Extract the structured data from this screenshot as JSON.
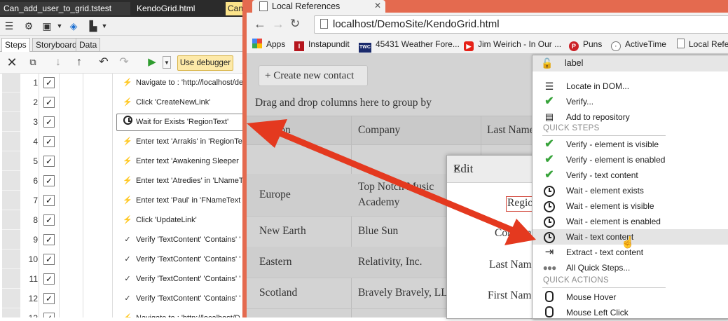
{
  "studio": {
    "doc_tabs": [
      "Can_add_user_to_grid.tstest",
      "KendoGrid.html",
      "Can"
    ],
    "sub_tabs": [
      "Steps",
      "Storyboard",
      "Data"
    ],
    "use_debugger_label": "Use debugger",
    "steps": [
      {
        "num": "1",
        "icon": "bolt",
        "text": "Navigate to : 'http://localhost/de"
      },
      {
        "num": "2",
        "icon": "bolt",
        "text": "Click 'CreateNewLink'"
      },
      {
        "num": "3",
        "icon": "clock",
        "text": "Wait for Exists 'RegionText'",
        "selected": true
      },
      {
        "num": "4",
        "icon": "bolt",
        "text": "Enter text 'Arrakis' in 'RegionTe"
      },
      {
        "num": "5",
        "icon": "bolt",
        "text": "Enter text 'Awakening Sleeper"
      },
      {
        "num": "6",
        "icon": "bolt",
        "text": "Enter text 'Atredies' in 'LNameT"
      },
      {
        "num": "7",
        "icon": "bolt",
        "text": "Enter text 'Paul' in 'FNameText"
      },
      {
        "num": "8",
        "icon": "bolt",
        "text": "Click 'UpdateLink'"
      },
      {
        "num": "9",
        "icon": "check",
        "text": "Verify 'TextContent' 'Contains' '"
      },
      {
        "num": "10",
        "icon": "check",
        "text": "Verify 'TextContent' 'Contains' '"
      },
      {
        "num": "11",
        "icon": "check",
        "text": "Verify 'TextContent' 'Contains' '"
      },
      {
        "num": "12",
        "icon": "check",
        "text": "Verify 'TextContent' 'Contains' '"
      },
      {
        "num": "13",
        "icon": "bolt",
        "text": "Navigate to : 'http://localhost/D"
      }
    ]
  },
  "browser": {
    "tab_title": "Local References",
    "url": "localhost/DemoSite/KendoGrid.html",
    "bookmarks": [
      "Apps",
      "Instapundit",
      "45431 Weather Fore...",
      "Jim Weirich - In Our ...",
      "Puns",
      "ActiveTime",
      "Local Refe"
    ],
    "page": {
      "create_button": "+ Create new contact",
      "group_by_text": "Drag and drop columns here to group by",
      "columns": [
        "Region",
        "Company",
        "Last Name"
      ],
      "rows": [
        {
          "region": "",
          "company": ""
        },
        {
          "region": "Europe",
          "company": "Top Notch Music Academy"
        },
        {
          "region": "New Earth",
          "company": "Blue Sun"
        },
        {
          "region": "Eastern",
          "company": "Relativity, Inc."
        },
        {
          "region": "Scotland",
          "company": "Bravely Bravely, LLC"
        }
      ],
      "edit_dialog": {
        "title": "Edit",
        "close": "×",
        "labels": [
          "Region",
          "Company",
          "Last Name",
          "First Name"
        ]
      }
    }
  },
  "context_menu": {
    "header_label": "label",
    "items": [
      {
        "icon": "locate",
        "text": "Locate in DOM..."
      },
      {
        "icon": "verify",
        "text": "Verify..."
      },
      {
        "icon": "repository",
        "text": "Add to repository"
      }
    ],
    "quick_steps_title": "QUICK STEPS",
    "quick_steps": [
      {
        "icon": "verify",
        "text": "Verify - element is visible"
      },
      {
        "icon": "verify",
        "text": "Verify - element is enabled"
      },
      {
        "icon": "verify",
        "text": "Verify - text content"
      },
      {
        "icon": "clock",
        "text": "Wait - element exists"
      },
      {
        "icon": "clock",
        "text": "Wait - element is visible"
      },
      {
        "icon": "clock",
        "text": "Wait - element is enabled"
      },
      {
        "icon": "clock",
        "text": "Wait - text content",
        "highlighted": true
      },
      {
        "icon": "extract",
        "text": "Extract - text content"
      },
      {
        "icon": "dots",
        "text": "All Quick Steps..."
      }
    ],
    "quick_actions_title": "QUICK ACTIONS",
    "quick_actions": [
      {
        "icon": "mouse",
        "text": "Mouse Hover"
      },
      {
        "icon": "mouse",
        "text": "Mouse Left Click"
      }
    ]
  },
  "colors": {
    "accent_red": "#e4391f",
    "verify_green": "#37a33a",
    "browser_frame": "#e46a4f"
  }
}
